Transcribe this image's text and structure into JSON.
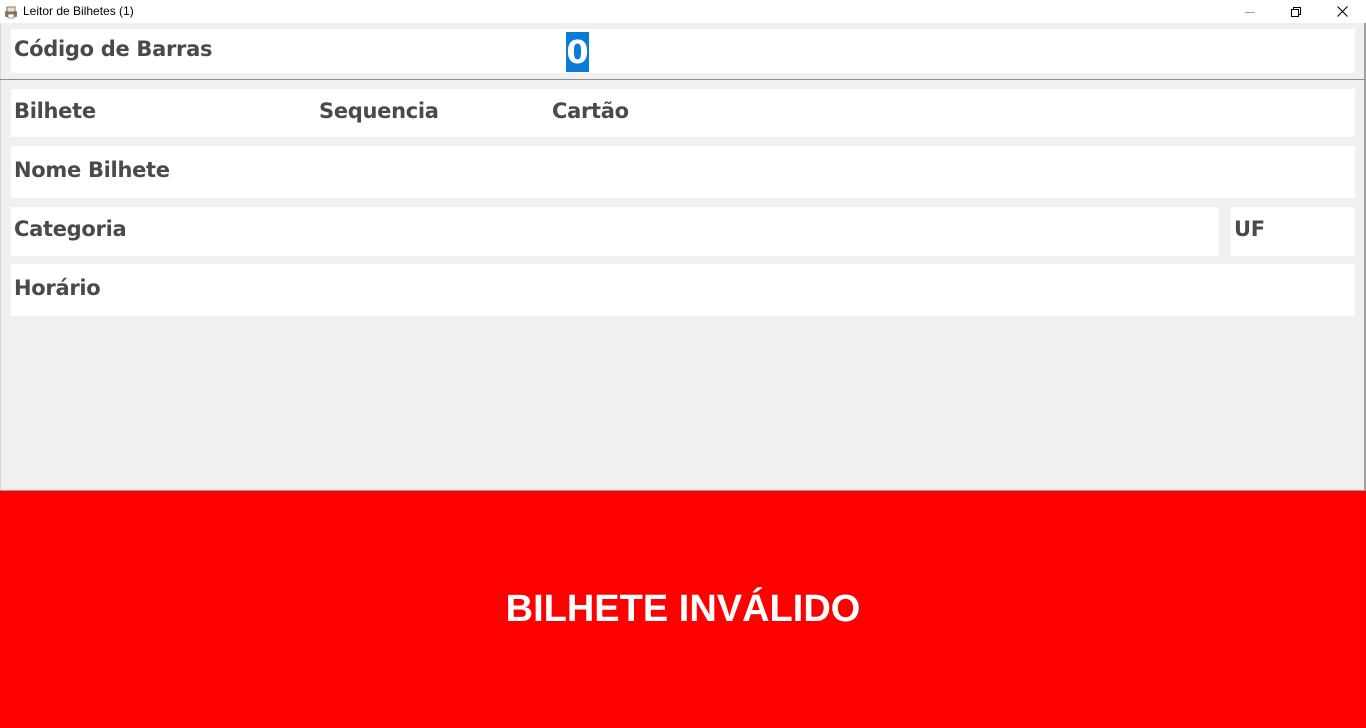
{
  "window": {
    "title": "Leitor de Bilhetes (1)",
    "icons": {
      "app": "printer-app-icon",
      "minimize": "minimize-icon",
      "maximize": "restore-icon",
      "close": "close-icon"
    }
  },
  "barcode": {
    "label": "Código de Barras",
    "value": "0"
  },
  "ticket": {
    "bilhete_label": "Bilhete",
    "sequencia_label": "Sequencia",
    "cartao_label": "Cartão",
    "nome_label": "Nome Bilhete",
    "categoria_label": "Categoria",
    "uf_label": "UF",
    "horario_label": "Horário"
  },
  "status": {
    "text": "BILHETE INVÁLIDO",
    "color": "#ff0000"
  },
  "colors": {
    "selection": "#0a7bd6",
    "label_text": "#4a4a4a",
    "background": "#f0f0f0"
  }
}
